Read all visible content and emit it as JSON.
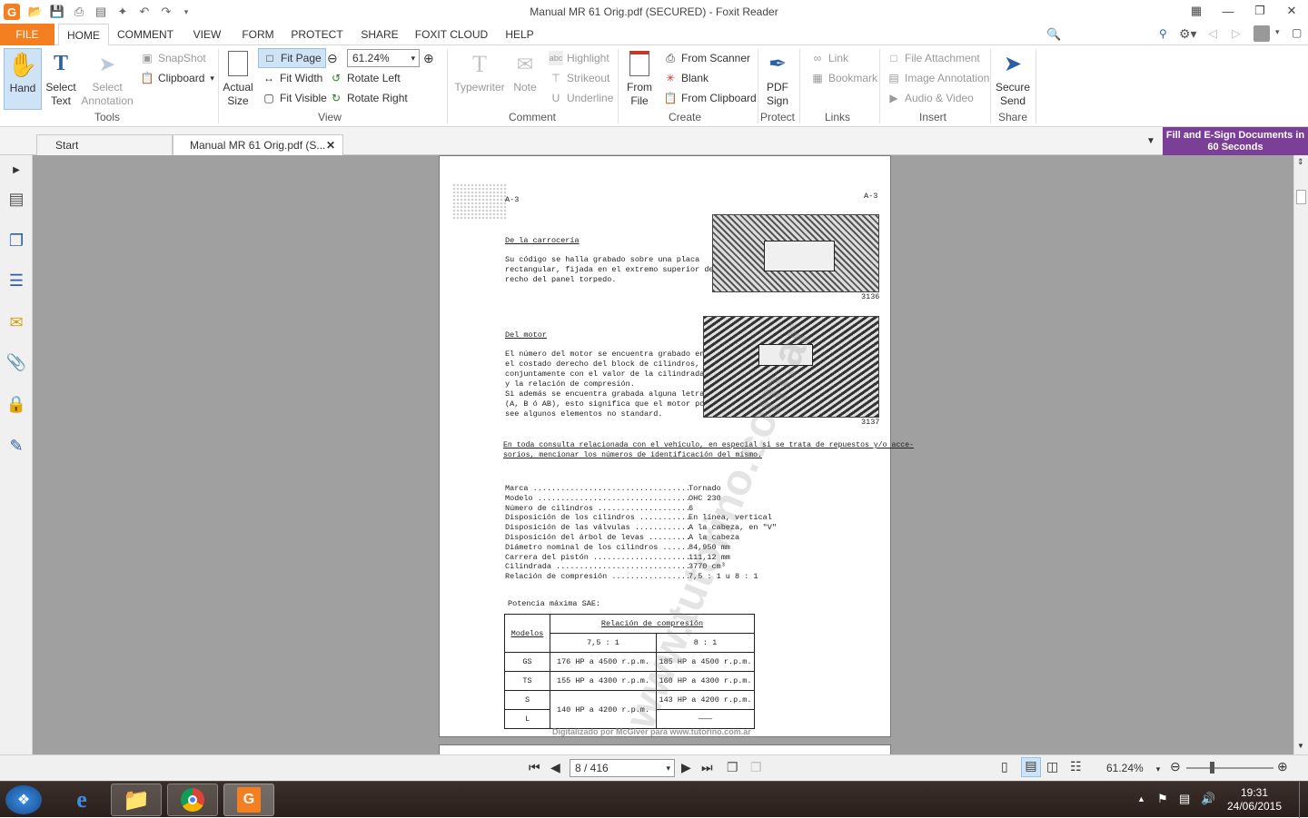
{
  "window": {
    "title": "Manual MR 61 Orig.pdf (SECURED) - Foxit Reader"
  },
  "menu": {
    "file": "FILE",
    "tabs": [
      "HOME",
      "COMMENT",
      "VIEW",
      "FORM",
      "PROTECT",
      "SHARE",
      "FOXIT CLOUD",
      "HELP"
    ],
    "find_placeholder": "Find"
  },
  "ribbon": {
    "tools": {
      "label": "Tools",
      "hand": "Hand",
      "select_text_1": "Select",
      "select_text_2": "Text",
      "select_annotation_1": "Select",
      "select_annotation_2": "Annotation",
      "snapshot": "SnapShot",
      "clipboard": "Clipboard"
    },
    "view": {
      "label": "View",
      "actual_size_1": "Actual",
      "actual_size_2": "Size",
      "fit_page": "Fit Page",
      "fit_width": "Fit Width",
      "fit_visible": "Fit Visible",
      "zoom": "61.24%",
      "rotate_left": "Rotate Left",
      "rotate_right": "Rotate Right"
    },
    "comment": {
      "label": "Comment",
      "typewriter": "Typewriter",
      "note": "Note",
      "highlight": "Highlight",
      "strikeout": "Strikeout",
      "underline": "Underline"
    },
    "create": {
      "label": "Create",
      "from_file_1": "From",
      "from_file_2": "File",
      "from_scanner": "From Scanner",
      "blank": "Blank",
      "from_clipboard": "From Clipboard"
    },
    "protect": {
      "label": "Protect",
      "pdf_sign_1": "PDF",
      "pdf_sign_2": "Sign"
    },
    "links": {
      "label": "Links",
      "link": "Link",
      "bookmark": "Bookmark"
    },
    "insert": {
      "label": "Insert",
      "file_attachment": "File Attachment",
      "image_annotation": "Image Annotation",
      "audio_video": "Audio & Video"
    },
    "share": {
      "label": "Share",
      "secure_send_1": "Secure",
      "secure_send_2": "Send"
    }
  },
  "tabs": {
    "start": "Start",
    "document": "Manual MR 61 Orig.pdf (S...",
    "promo": "Fill and E-Sign Documents in 60 Seconds"
  },
  "page": {
    "header_left": "A-3",
    "header_right": "A-3",
    "s1_title": "De la carrocería",
    "s1_lines": [
      "Su código se halla grabado sobre una placa",
      "rectangular, fijada en el extremo superior de",
      "recho del panel torpedo."
    ],
    "fig1": "3136",
    "s2_title": "Del motor",
    "s2_lines": [
      "El número del motor se encuentra grabado en",
      "el costado derecho del block de cilindros,",
      "conjuntamente con el valor de la cilindrada",
      "y la relación de compresión.",
      "Si además se encuentra grabada alguna letra",
      "(A, B ó AB), esto significa que el motor po",
      "see algunos elementos no standard."
    ],
    "fig2": "3137",
    "notice_1": "En toda consulta relacionada con el vehículo, en especial si se trata de repuestos y/o acce-",
    "notice_2": "sorios, mencionar los números de identificación del mismo.",
    "specs": [
      {
        "k": "Marca ..................................",
        "v": "Tornado"
      },
      {
        "k": "Modelo .................................",
        "v": "OHC 230"
      },
      {
        "k": "Número de cilindros ....................",
        "v": "6"
      },
      {
        "k": "Disposición de los cilindros ...........",
        "v": "En línea, vertical"
      },
      {
        "k": "Disposición de las válvulas ............",
        "v": "A la cabeza, en \"V\""
      },
      {
        "k": "Disposición del árbol de levas .........",
        "v": "A la cabeza"
      },
      {
        "k": "Diámetro nominal de los cilindros ......",
        "v": "84,950 mm"
      },
      {
        "k": "Carrera del pistón .....................",
        "v": "111,12 mm"
      },
      {
        "k": "Cilindrada .............................",
        "v": "3770 cm³"
      },
      {
        "k": "Relación de compresión .................",
        "v": "7,5 : 1  u 8 : 1"
      }
    ],
    "power_title": "Potencia máxima SAE:",
    "table": {
      "col_models": "Modelos",
      "col_ratio": "Relación de compresión",
      "ratio_a": "7,5 : 1",
      "ratio_b": "8 : 1",
      "r_gs": "GS",
      "r_ts": "TS",
      "r_s": "S",
      "r_l": "L",
      "gs_a": "176 HP a 4500 r.p.m.",
      "gs_b": "185 HP a 4500 r.p.m.",
      "ts_a": "155 HP a 4300 r.p.m.",
      "ts_b": "160 HP a 4300 r.p.m.",
      "sl_a": "140 HP a 4200 r.p.m.",
      "s_b": "143 HP a 4200 r.p.m.",
      "l_b": "———"
    },
    "footer": "Digitalizado por McGiver para www.tutorino.com.ar",
    "watermark": "www.tutorino.com.ar"
  },
  "status": {
    "page": "8 / 416",
    "zoom": "61.24%"
  },
  "taskbar": {
    "time": "19:31",
    "date": "24/06/2015"
  }
}
